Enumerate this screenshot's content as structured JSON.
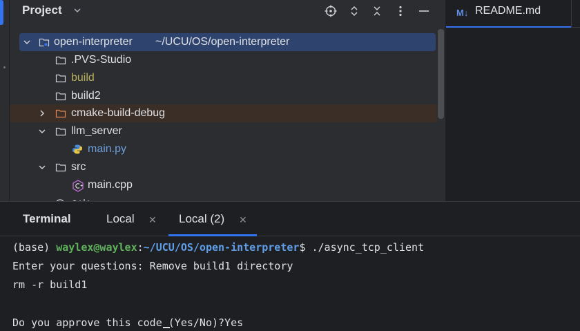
{
  "project_panel": {
    "title": "Project",
    "tree": [
      {
        "name": "open-interpreter",
        "path": "~/UCU/OS/open-interpreter",
        "kind": "root-folder",
        "expanded": true,
        "selected": true
      },
      {
        "name": ".PVS-Studio",
        "kind": "folder"
      },
      {
        "name": "build",
        "kind": "folder",
        "style": "excluded"
      },
      {
        "name": "build2",
        "kind": "folder"
      },
      {
        "name": "cmake-build-debug",
        "kind": "folder",
        "expanded": false,
        "style": "cmake"
      },
      {
        "name": "llm_server",
        "kind": "folder",
        "expanded": true
      },
      {
        "name": "main.py",
        "kind": "python-file"
      },
      {
        "name": "src",
        "kind": "folder",
        "expanded": true
      },
      {
        "name": "main.cpp",
        "kind": "cpp-file"
      }
    ]
  },
  "editor": {
    "tab_icon": "M↓",
    "tab_label": "README.md"
  },
  "terminal": {
    "title": "Terminal",
    "tabs": [
      {
        "label": "Local"
      },
      {
        "label": "Local (2)",
        "active": true
      }
    ],
    "prompt_env": "(base) ",
    "prompt_user": "waylex@waylex",
    "prompt_colon": ":",
    "prompt_path": "~/UCU/OS/open-interpreter",
    "prompt_dollar": "$ ",
    "command": "./async_tcp_client",
    "lines": [
      "Enter your questions: Remove build1 directory",
      "rm -r build1",
      "",
      "Do you approve this code (Yes/No)?Yes"
    ]
  },
  "colors": {
    "accent": "#3574f0",
    "panel_bg": "#2b2d30",
    "editor_bg": "#1e1f22",
    "selection": "#2e436e",
    "excluded_folder_text": "#b9b05c",
    "python_file_text": "#6e9fdc",
    "prompt_user": "#5fb15c",
    "prompt_path": "#5f9ee8"
  }
}
